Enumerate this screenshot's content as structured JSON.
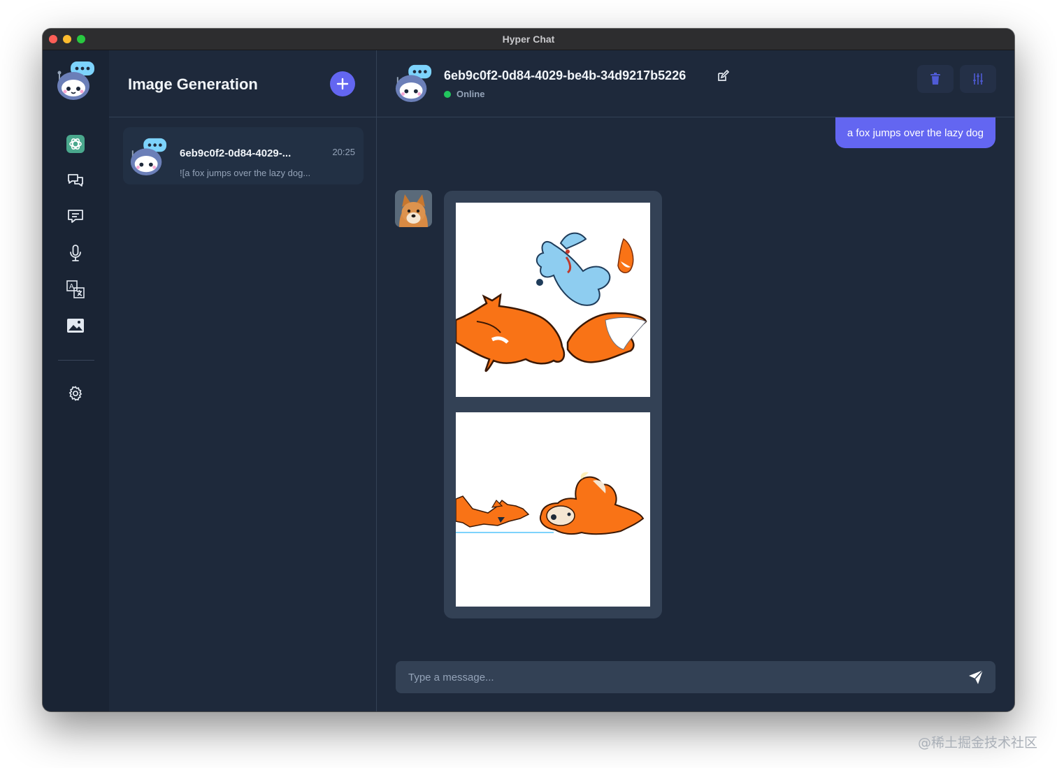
{
  "window": {
    "title": "Hyper Chat"
  },
  "sidebar": {
    "icons": [
      "openai-icon",
      "chat-bubbles-icon",
      "message-icon",
      "microphone-icon",
      "translate-icon",
      "image-icon",
      "gear-icon"
    ]
  },
  "list": {
    "title": "Image Generation",
    "conversations": [
      {
        "name": "6eb9c0f2-0d84-4029-...",
        "time": "20:25",
        "preview": "![a fox jumps over the lazy dog..."
      }
    ]
  },
  "chat": {
    "title": "6eb9c0f2-0d84-4029-be4b-34d9217b5226",
    "status": "Online",
    "messages": [
      {
        "role": "user",
        "text": "a fox jumps over the lazy dog"
      },
      {
        "role": "assistant",
        "type": "images",
        "count": 2
      }
    ],
    "input": {
      "placeholder": "Type a message..."
    }
  },
  "colors": {
    "accent": "#6366f1",
    "bg": "#1e293b",
    "online": "#22c55e"
  },
  "watermark": "@稀土掘金技术社区"
}
